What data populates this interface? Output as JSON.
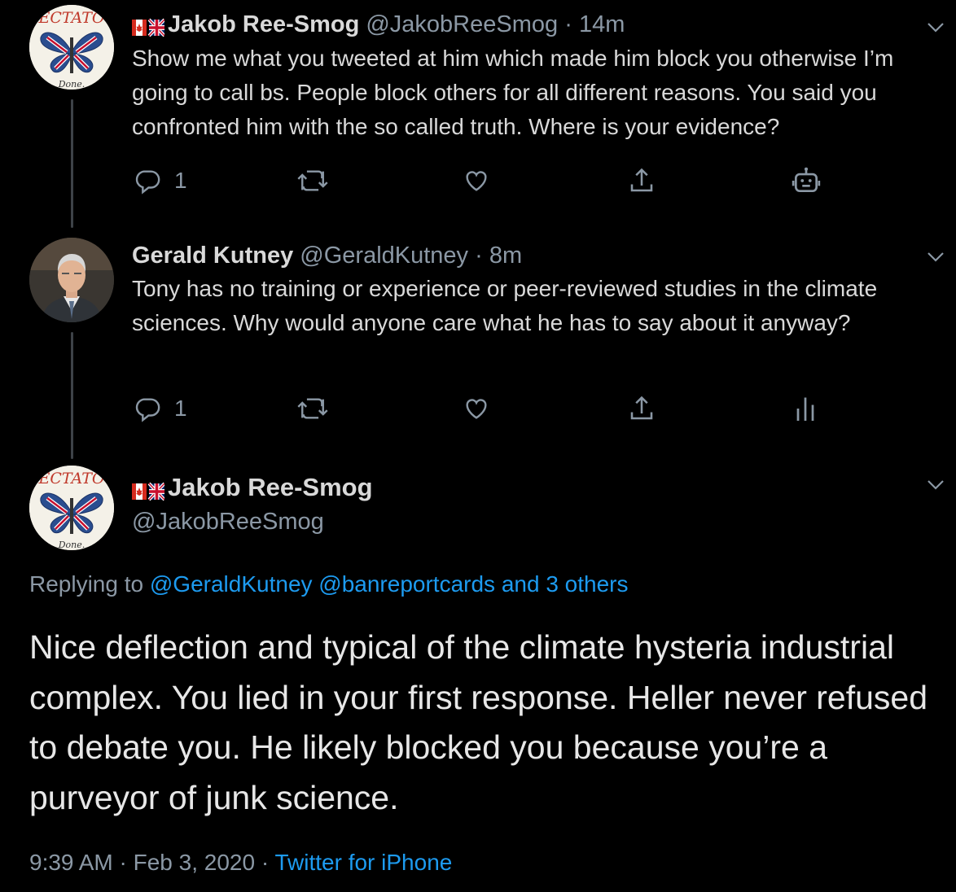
{
  "tweets": [
    {
      "name": "Jakob Ree-Smog",
      "handle": "@JakobReeSmog",
      "sep": "·",
      "time": "14m",
      "text": "Show me what you tweeted at him which made him block you otherwise I’m going to call bs. People block others for all different reasons. You said you confronted him with the so called truth. Where is your evidence?",
      "reply_count": "1",
      "avatar_text_top": "ECTATO",
      "avatar_text_bottom": "Done."
    },
    {
      "name": "Gerald Kutney",
      "handle": "@GeraldKutney",
      "sep": "·",
      "time": "8m",
      "text": "Tony has no training or experience or peer-reviewed studies in the climate sciences. Why would anyone care what he has to say about it anyway?",
      "reply_count": "1"
    }
  ],
  "main_tweet": {
    "name": "Jakob Ree-Smog",
    "handle": "@JakobReeSmog",
    "avatar_text_top": "ECTATO",
    "avatar_text_bottom": "Done.",
    "replying_prefix": "Replying to",
    "replying_handles": "@GeraldKutney @banreportcards and 3 others",
    "text": "Nice deflection and typical of the climate hysteria industrial complex. You lied in your first response. Heller never refused to debate you. He likely blocked you because you’re a purveyor of junk science.",
    "time": "9:39 AM",
    "sep1": "·",
    "date": "Feb 3, 2020",
    "sep2": "·",
    "source": "Twitter for iPhone"
  },
  "colors": {
    "background": "#000000",
    "text": "#d9d9d9",
    "muted": "#8b98a5",
    "link": "#1d9bf0"
  },
  "icons": [
    "reply-icon",
    "retweet-icon",
    "like-icon",
    "share-icon",
    "bot-icon",
    "analytics-icon",
    "chevron-down-icon",
    "canada-flag-icon",
    "uk-flag-icon"
  ]
}
